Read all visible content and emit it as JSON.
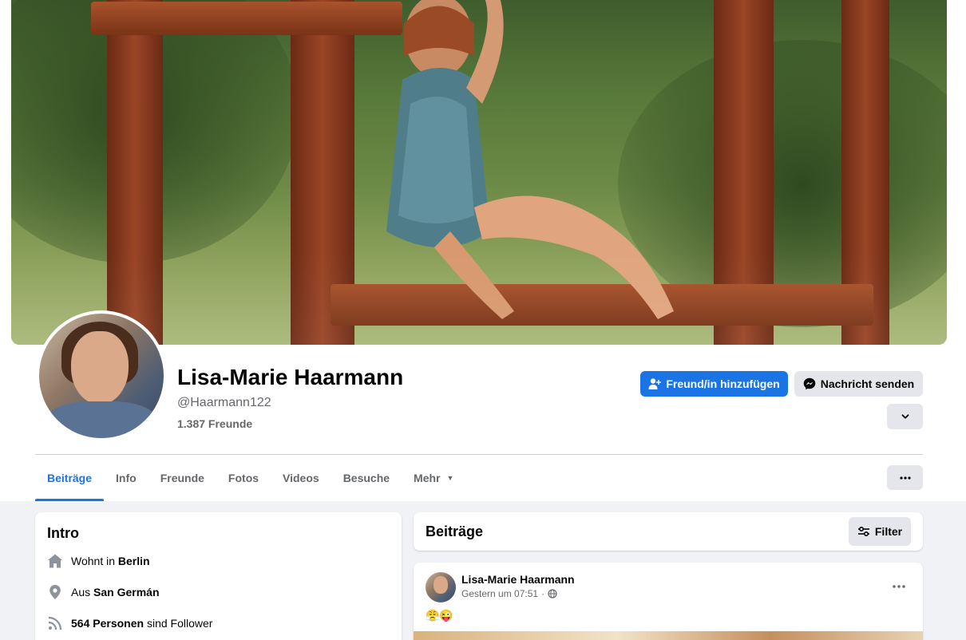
{
  "profile": {
    "name": "Lisa-Marie Haarmann",
    "handle": "@Haarmann122",
    "friends": "1.387 Freunde"
  },
  "actions": {
    "add_friend": "Freund/in hinzufügen",
    "send_message": "Nachricht senden"
  },
  "tabs": [
    {
      "label": "Beiträge",
      "active": true
    },
    {
      "label": "Info"
    },
    {
      "label": "Freunde"
    },
    {
      "label": "Fotos"
    },
    {
      "label": "Videos"
    },
    {
      "label": "Besuche"
    },
    {
      "label": "Mehr"
    }
  ],
  "intro": {
    "title": "Intro",
    "lives_prefix": "Wohnt in ",
    "lives_city": "Berlin",
    "from_prefix": "Aus ",
    "from_city": "San Germán",
    "followers_bold": "564 Personen",
    "followers_suffix": " sind Follower"
  },
  "posts": {
    "title": "Beiträge",
    "filter_label": "Filter",
    "first_post": {
      "author": "Lisa-Marie Haarmann",
      "timestamp": "Gestern um 07:51",
      "separator": "·",
      "content": "😤😜"
    }
  },
  "icons": {
    "add_friend": "person-add-icon",
    "messenger": "messenger-icon",
    "chevron": "chevron-down-icon",
    "more": "more-dots-icon",
    "home": "home-icon",
    "location": "location-pin-icon",
    "rss": "rss-icon",
    "filter": "filter-sliders-icon",
    "globe": "globe-icon"
  },
  "colors": {
    "accent": "#1b74e4",
    "background": "#f0f2f5",
    "secondary_text": "#65676b",
    "button_grey": "#e4e6eb"
  }
}
